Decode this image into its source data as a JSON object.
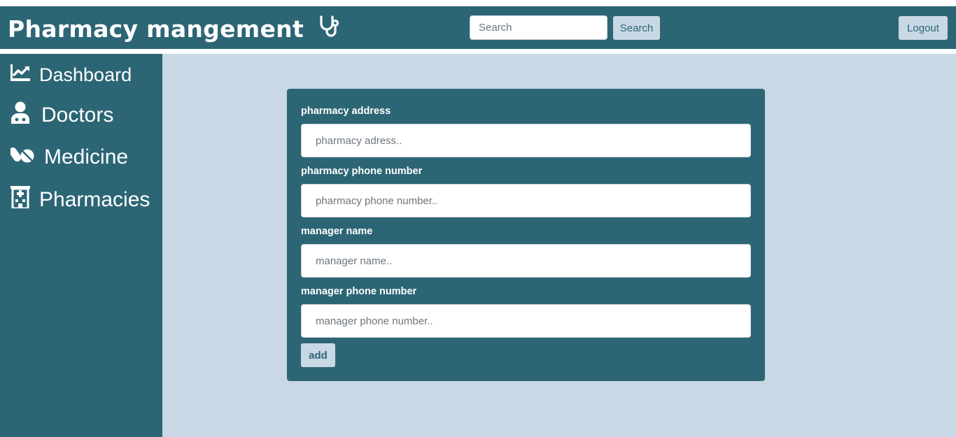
{
  "header": {
    "title": "Pharmacy mangement",
    "brand_icon": "stethoscope-icon",
    "search_placeholder": "Search",
    "search_button": "Search",
    "logout_button": "Logout"
  },
  "sidebar": {
    "items": [
      {
        "label": "Dashboard",
        "icon": "chart-line-icon"
      },
      {
        "label": "Doctors",
        "icon": "user-doctor-icon"
      },
      {
        "label": "Medicine",
        "icon": "pills-icon"
      },
      {
        "label": "Pharmacies",
        "icon": "hospital-icon"
      }
    ]
  },
  "form": {
    "fields": [
      {
        "label": "pharmacy address",
        "placeholder": "pharmacy adress..",
        "value": ""
      },
      {
        "label": "pharmacy phone number",
        "placeholder": "pharmacy phone number..",
        "value": ""
      },
      {
        "label": "manager name",
        "placeholder": "manager name..",
        "value": ""
      },
      {
        "label": "manager phone number",
        "placeholder": "manager phone number..",
        "value": ""
      }
    ],
    "submit_label": "add"
  },
  "colors": {
    "primary": "#2c6675",
    "background": "#c8d8e4",
    "button": "#c8d8e4"
  }
}
